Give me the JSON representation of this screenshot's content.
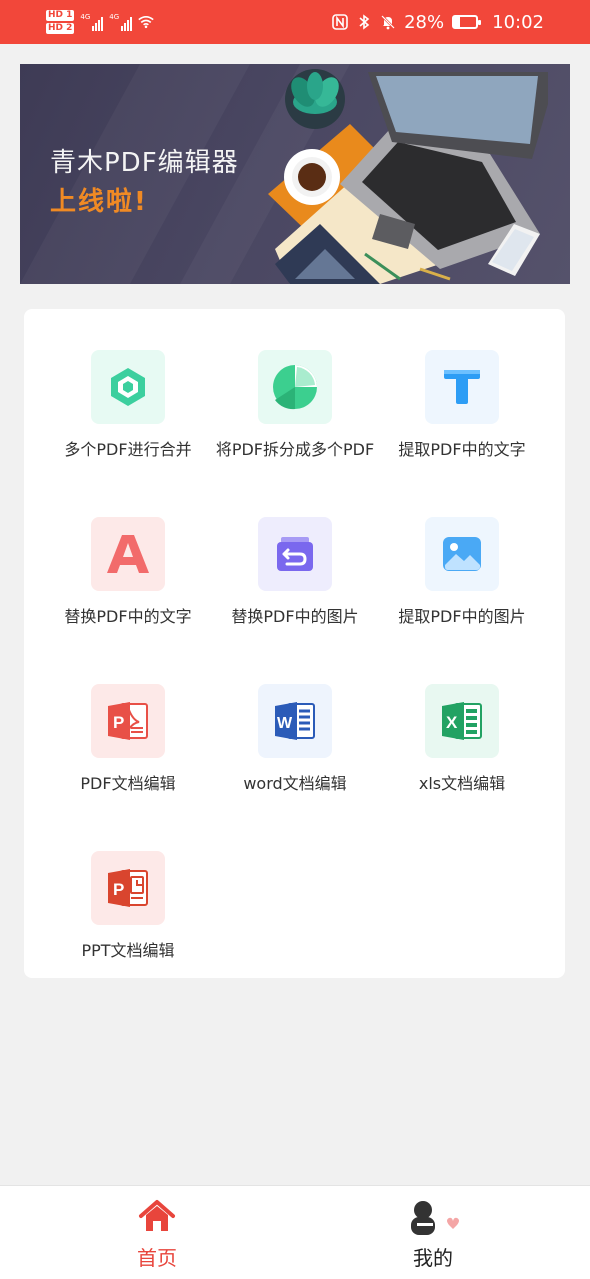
{
  "status_bar": {
    "sim1": "HD 1",
    "sim2": "HD 2",
    "network1": "4G",
    "network2": "4G",
    "battery": "28%",
    "battery_level": 0.28,
    "time": "10:02"
  },
  "banner": {
    "title": "青木PDF编辑器",
    "subtitle": "上线啦!"
  },
  "tools": [
    {
      "label": "多个PDF进行合并",
      "icon": "merge-icon",
      "tile_color": "#e7faf3"
    },
    {
      "label": "将PDF拆分成多个PDF",
      "icon": "pie-split-icon",
      "tile_color": "#e7faf3"
    },
    {
      "label": "提取PDF中的文字",
      "icon": "text-t-icon",
      "tile_color": "#eef6fe"
    },
    {
      "label": "替换PDF中的文字",
      "icon": "letter-a-icon",
      "tile_color": "#fde9e8"
    },
    {
      "label": "替换PDF中的图片",
      "icon": "image-replace-icon",
      "tile_color": "#eeedfd"
    },
    {
      "label": "提取PDF中的图片",
      "icon": "image-icon",
      "tile_color": "#eef6fe"
    },
    {
      "label": "PDF文档编辑",
      "icon": "pdf-file-icon",
      "tile_color": "#fde9e8"
    },
    {
      "label": "word文档编辑",
      "icon": "word-icon",
      "tile_color": "#eef4fd"
    },
    {
      "label": "xls文档编辑",
      "icon": "excel-icon",
      "tile_color": "#e8f8f1"
    },
    {
      "label": "PPT文档编辑",
      "icon": "ppt-icon",
      "tile_color": "#fde9e8"
    }
  ],
  "bottom_nav": {
    "home_label": "首页",
    "mine_label": "我的",
    "active_color": "#e8453c"
  }
}
